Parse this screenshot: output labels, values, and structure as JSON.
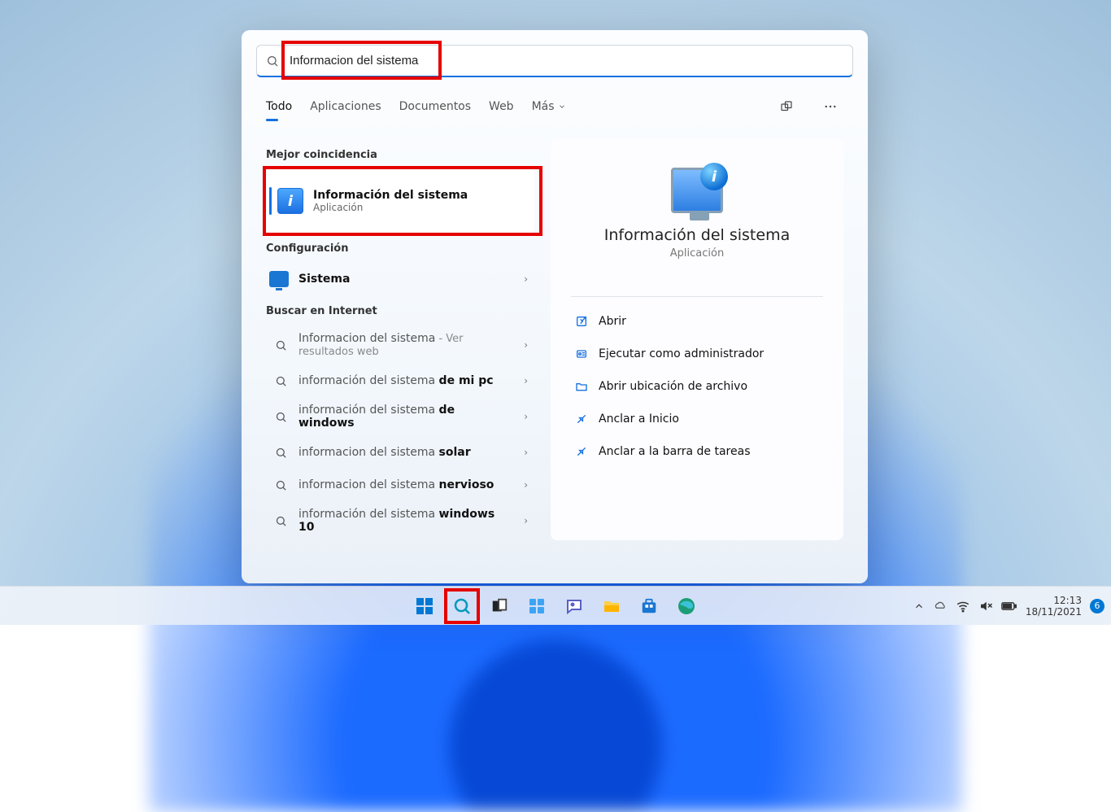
{
  "search": {
    "value": "Informacion del sistema"
  },
  "tabs": {
    "todo": "Todo",
    "aplicaciones": "Aplicaciones",
    "documentos": "Documentos",
    "web": "Web",
    "mas": "Más"
  },
  "sections": {
    "best_match": "Mejor coincidencia",
    "configuration": "Configuración",
    "search_web": "Buscar en Internet"
  },
  "best": {
    "title": "Información del sistema",
    "subtitle": "Aplicación"
  },
  "config": {
    "sistema": "Sistema"
  },
  "web_results": {
    "r1_pre": "Informacion del sistema",
    "r1_sub": " - Ver resultados web",
    "r2_pre": "información del sistema ",
    "r2_bold": "de mi pc",
    "r3_pre": "información del sistema ",
    "r3_bold": "de windows",
    "r4_pre": "informacion del sistema ",
    "r4_bold": "solar",
    "r5_pre": "informacion del sistema ",
    "r5_bold": "nervioso",
    "r6_pre": "información del sistema ",
    "r6_bold": "windows 10"
  },
  "preview": {
    "title": "Información del sistema",
    "subtitle": "Aplicación",
    "open": "Abrir",
    "run_admin": "Ejecutar como administrador",
    "open_location": "Abrir ubicación de archivo",
    "pin_start": "Anclar a Inicio",
    "pin_taskbar": "Anclar a la barra de tareas"
  },
  "tray": {
    "time": "12:13",
    "date": "18/11/2021",
    "notifications": "6"
  }
}
